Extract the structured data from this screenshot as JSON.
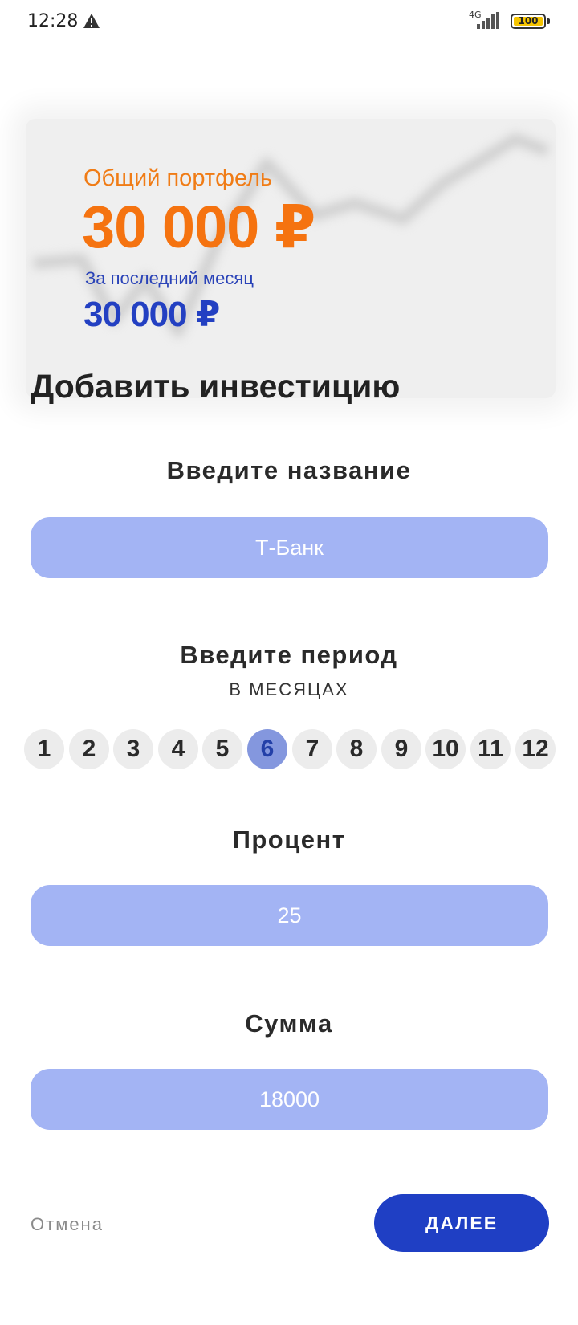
{
  "status_bar": {
    "time": "12:28",
    "network": "4G",
    "battery": "100",
    "warning_icon": "warning-triangle-icon"
  },
  "portfolio": {
    "label": "Общий портфель",
    "total": "30 000 ₽",
    "month_label": "За последний месяц",
    "month_total": "30 000 ₽",
    "colors": {
      "total": "#f57310",
      "month": "#2340c2"
    }
  },
  "page": {
    "title": "Добавить инвестицию"
  },
  "name_section": {
    "label": "Введите название",
    "placeholder": "Т-Банк"
  },
  "period_section": {
    "label": "Введите период",
    "sublabel": "В МЕСЯЦАХ",
    "months": [
      "1",
      "2",
      "3",
      "4",
      "5",
      "6",
      "7",
      "8",
      "9",
      "10",
      "11",
      "12"
    ],
    "selected": "6"
  },
  "percent_section": {
    "label": "Процент",
    "placeholder": "25"
  },
  "sum_section": {
    "label": "Сумма",
    "placeholder": "18000"
  },
  "actions": {
    "cancel": "Отмена",
    "next": "ДАЛЕЕ"
  },
  "colors": {
    "accent": "#1f3fc4",
    "field": "#a3b4f4",
    "chip": "#ececec",
    "chip_selected": "#8497de"
  }
}
